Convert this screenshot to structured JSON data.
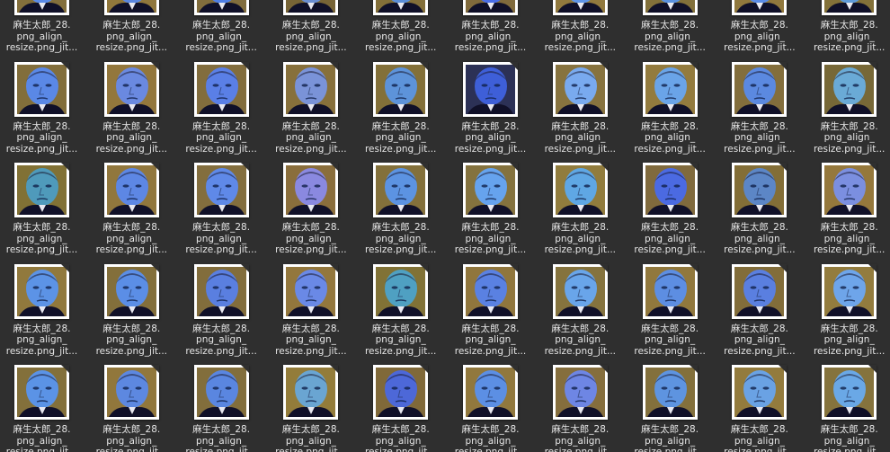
{
  "window": {
    "background": "#2f2f2f"
  },
  "file_label": {
    "line1": "麻生太郎_28.",
    "line2": "png_align_",
    "line3": "resize.png_jit..."
  },
  "icon_name": "image-thumbnail-icon",
  "thumbnail_tints": [
    [
      "#5b8be8",
      "#5a86e0",
      "#4f7fe6",
      "#6a8ed2",
      "#5b8ed8",
      "#4a6ee8",
      "#5f95e8",
      "#5a91e0",
      "#5a8be6",
      "#5f9ad8"
    ],
    [
      "#5a88e6",
      "#6a89e0",
      "#5a7fe6",
      "#7a93d8",
      "#5d93da",
      "#3e5fd8",
      "#79aaef",
      "#6aa4e8",
      "#5b89e0",
      "#6aaad6"
    ],
    [
      "#4f9abb",
      "#5d87e4",
      "#5f89e8",
      "#8a89e0",
      "#5c93e2",
      "#66a3ee",
      "#5fa7e4",
      "#4b6ae2",
      "#5c86c6",
      "#7b8fe0"
    ],
    [
      "#5c93e6",
      "#5b8ee6",
      "#5a7fe0",
      "#6a89e6",
      "#4fa0c2",
      "#5a81e2",
      "#69a5ea",
      "#5d8ee2",
      "#5a7fe0",
      "#6ea5ea"
    ],
    [
      "#5b93e6",
      "#5d88e0",
      "#5a86e0",
      "#6aa5d2",
      "#4d68d8",
      "#5c8fe4",
      "#6e86e4",
      "#5e94e0",
      "#6aa2e4",
      "#6aa8e6"
    ]
  ],
  "thumbnail_backgrounds": [
    [
      "#8a6a1e",
      "#9a7520",
      "#8a6a20",
      "#7a5d1c",
      "#8a6a1e",
      "#8a6a1e",
      "#9a7520",
      "#8a6a1e",
      "#9a7520",
      "#8a6a1e"
    ],
    [
      "#8a6a1e",
      "#9a7520",
      "#8a6a20",
      "#8a6a20",
      "#8a6a1e",
      "#2a2a40",
      "#8a6a20",
      "#9a7520",
      "#8a6a20",
      "#7a5d1c"
    ],
    [
      "#8a6a1e",
      "#9a7520",
      "#8a6a20",
      "#8a6a20",
      "#8a6a1e",
      "#8a6a20",
      "#9a7520",
      "#8a6a20",
      "#8a6a1e",
      "#9a7520"
    ],
    [
      "#9a7520",
      "#8a6a1e",
      "#8a6a20",
      "#9a7520",
      "#8a6a1e",
      "#9a7520",
      "#8a6a20",
      "#9a7520",
      "#8a6a1e",
      "#9a7520"
    ],
    [
      "#8a6a1e",
      "#9a7520",
      "#8a6a20",
      "#9a7520",
      "#8a6a1e",
      "#9a7520",
      "#8a6a20",
      "#8a6a20",
      "#9a7520",
      "#8a6a20"
    ]
  ]
}
